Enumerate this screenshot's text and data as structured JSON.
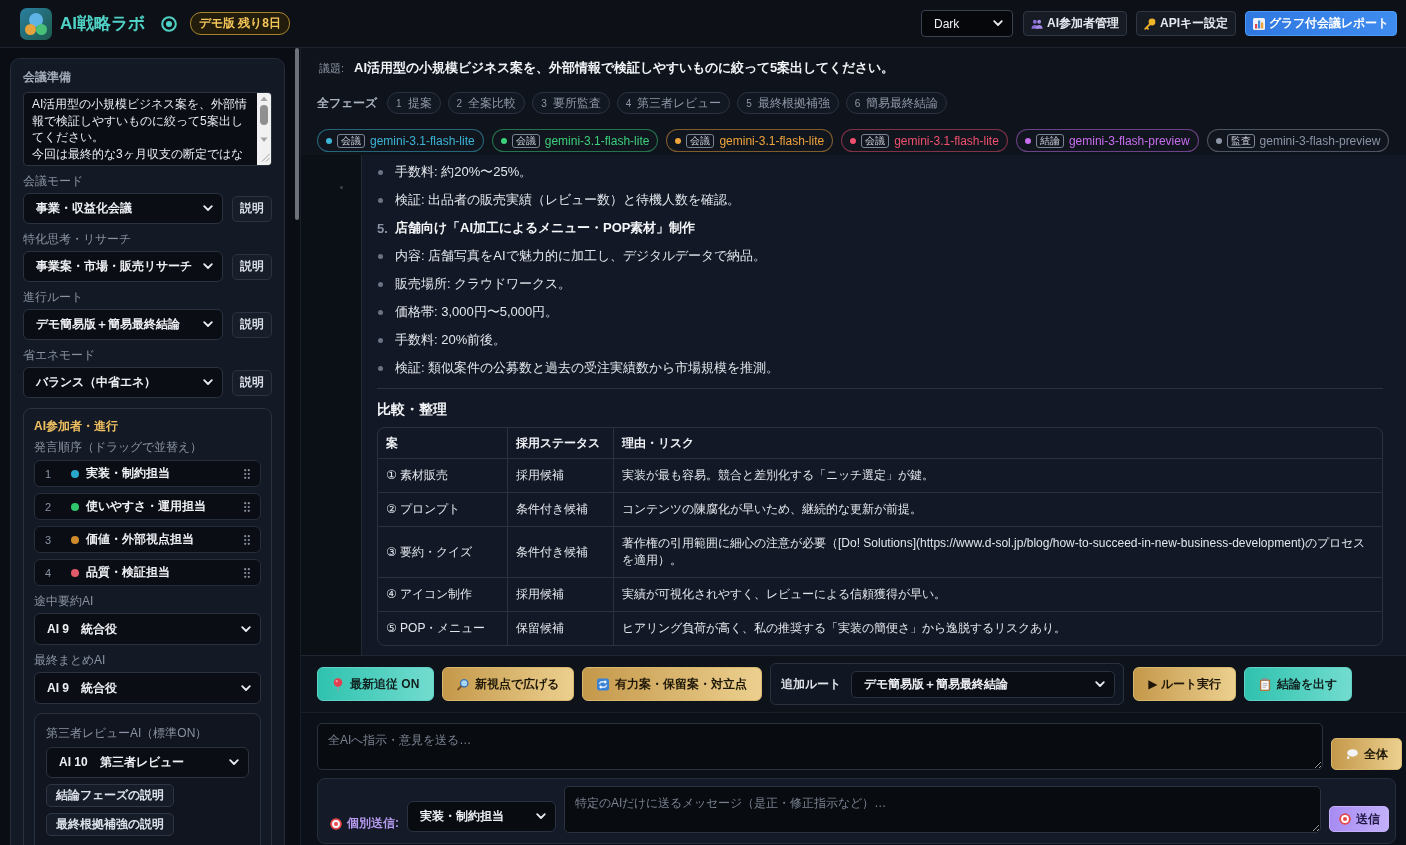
{
  "header": {
    "app_title": "AI戦略ラボ",
    "badge": "デモ版 残り8日",
    "theme": "Dark",
    "buttons": [
      {
        "label": "AI参加者管理",
        "kind": "default"
      },
      {
        "label": "APIキー設定",
        "kind": "default"
      },
      {
        "label": "グラフ付会議レポート",
        "kind": "primary"
      }
    ]
  },
  "sidebar": {
    "title": "会議準備",
    "topic": [
      "AI活用型の小規模ビジネス案を、外部情報で検証しやすいものに絞って5案出してください。",
      "今回は最終的な3ヶ月収支の断定ではな"
    ],
    "settings": [
      {
        "label": "会議モード",
        "value": "事業・収益化会議",
        "button": "説明"
      },
      {
        "label": "特化思考・リサーチ",
        "value": "事業案・市場・販売リサーチ",
        "button": "説明"
      },
      {
        "label": "進行ルート",
        "value": "デモ簡易版＋簡易最終結論",
        "button": "説明"
      },
      {
        "label": "省エネモード",
        "value": "バランス（中省エネ）",
        "button": "説明"
      }
    ],
    "participants": {
      "title": "AI参加者・進行",
      "order_label": "発言順序（ドラッグで並替え）",
      "speakers": [
        {
          "number": "1",
          "name": "実装・制約担当",
          "color": "#2aa8cc"
        },
        {
          "number": "2",
          "name": "使いやすさ・運用担当",
          "color": "#30c46c"
        },
        {
          "number": "3",
          "name": "価値・外部視点担当",
          "color": "#d08c2c"
        },
        {
          "number": "4",
          "name": "品質・検証担当",
          "color": "#e05a6a"
        }
      ],
      "summary_label": "途中要約AI",
      "summary_value": "AI 9　統合役",
      "final_label": "最終まとめAI",
      "final_value": "AI 9　統合役",
      "review": {
        "label": "第三者レビューAI（標準ON）",
        "value": "AI 10　第三者レビュー",
        "buttons": [
          "結論フェーズの説明",
          "最終根拠補強の説明"
        ]
      }
    }
  },
  "main": {
    "topic_label": "議題:",
    "topic": "AI活用型の小規模ビジネス案を、外部情報で検証しやすいものに絞って5案出してください。",
    "phases_label": "全フェーズ",
    "phases": [
      {
        "number": "1",
        "label": "提案",
        "selected": false
      },
      {
        "number": "2",
        "label": "全案比較",
        "selected": false
      },
      {
        "number": "3",
        "label": "要所監査",
        "selected": false
      },
      {
        "number": "4",
        "label": "第三者レビュー",
        "selected": false
      },
      {
        "number": "5",
        "label": "最終根拠補強",
        "selected": false
      },
      {
        "number": "6",
        "label": "簡易最終結論",
        "selected": false
      }
    ],
    "models": [
      {
        "role": "会議",
        "name": "gemini-3.1-flash-lite",
        "color": "#3bb6d6"
      },
      {
        "role": "会議",
        "name": "gemini-3.1-flash-lite",
        "color": "#3ccf7c"
      },
      {
        "role": "会議",
        "name": "gemini-3.1-flash-lite",
        "color": "#f0a43a"
      },
      {
        "role": "会議",
        "name": "gemini-3.1-flash-lite",
        "color": "#f0506e"
      },
      {
        "role": "結論",
        "name": "gemini-3-flash-preview",
        "color": "#c86ef0"
      },
      {
        "role": "監査",
        "name": "gemini-3-flash-preview",
        "color": "#8b95a6"
      }
    ],
    "message": {
      "items": [
        {
          "kind": "bullet",
          "text": "手数料: 約20%〜25%。"
        },
        {
          "kind": "bullet",
          "text": "検証: 出品者の販売実績（レビュー数）と待機人数を確認。"
        },
        {
          "kind": "numbered",
          "number": "5.",
          "text": "店舗向け「AI加工によるメニュー・POP素材」制作"
        },
        {
          "kind": "bullet",
          "text": "内容: 店舗写真をAIで魅力的に加工し、デジタルデータで納品。"
        },
        {
          "kind": "bullet",
          "text": "販売場所: クラウドワークス。"
        },
        {
          "kind": "bullet",
          "text": "価格帯: 3,000円〜5,000円。"
        },
        {
          "kind": "bullet",
          "text": "手数料: 20%前後。"
        },
        {
          "kind": "bullet",
          "text": "検証: 類似案件の公募数と過去の受注実績数から市場規模を推測。"
        }
      ],
      "section_title": "比較・整理",
      "table": {
        "columns": [
          "案",
          "採用ステータス",
          "理由・リスク"
        ],
        "rows": [
          [
            "① 素材販売",
            "採用候補",
            "実装が最も容易。競合と差別化する「ニッチ選定」が鍵。"
          ],
          [
            "② プロンプト",
            "条件付き候補",
            "コンテンツの陳腐化が早いため、継続的な更新が前提。"
          ],
          [
            "③ 要約・クイズ",
            "条件付き候補",
            "著作権の引用範囲に細心の注意が必要（[Do! Solutions](https://www.d-sol.jp/blog/how-to-succeed-in-new-business-development)のプロセスを適用）。"
          ],
          [
            "④ アイコン制作",
            "採用候補",
            "実績が可視化されやすく、レビューによる信頼獲得が早い。"
          ],
          [
            "⑤ POP・メニュー",
            "保留候補",
            "ヒアリング負荷が高く、私の推奨する「実装の簡便さ」から逸脱するリスクあり。"
          ]
        ]
      }
    },
    "actions": [
      {
        "label": "最新追従 ON",
        "kind": "teal"
      },
      {
        "label": "新視点で広げる",
        "kind": "gold"
      },
      {
        "label": "有力案・保留案・対立点",
        "kind": "gold"
      }
    ],
    "route": {
      "label": "追加ルート",
      "value": "デモ簡易版＋簡易最終結論",
      "buttons": [
        {
          "label": "▶ ルート実行",
          "kind": "gold"
        },
        {
          "label": "結論を出す",
          "kind": "teal"
        }
      ]
    },
    "broadcast": {
      "placeholder": "全AIへ指示・意見を送る…",
      "button": "全体"
    },
    "direct": {
      "label": "個別送信:",
      "target": "実装・制約担当",
      "placeholder": "特定のAIだけに送るメッセージ（是正・修正指示など）…",
      "button": "送信"
    }
  }
}
